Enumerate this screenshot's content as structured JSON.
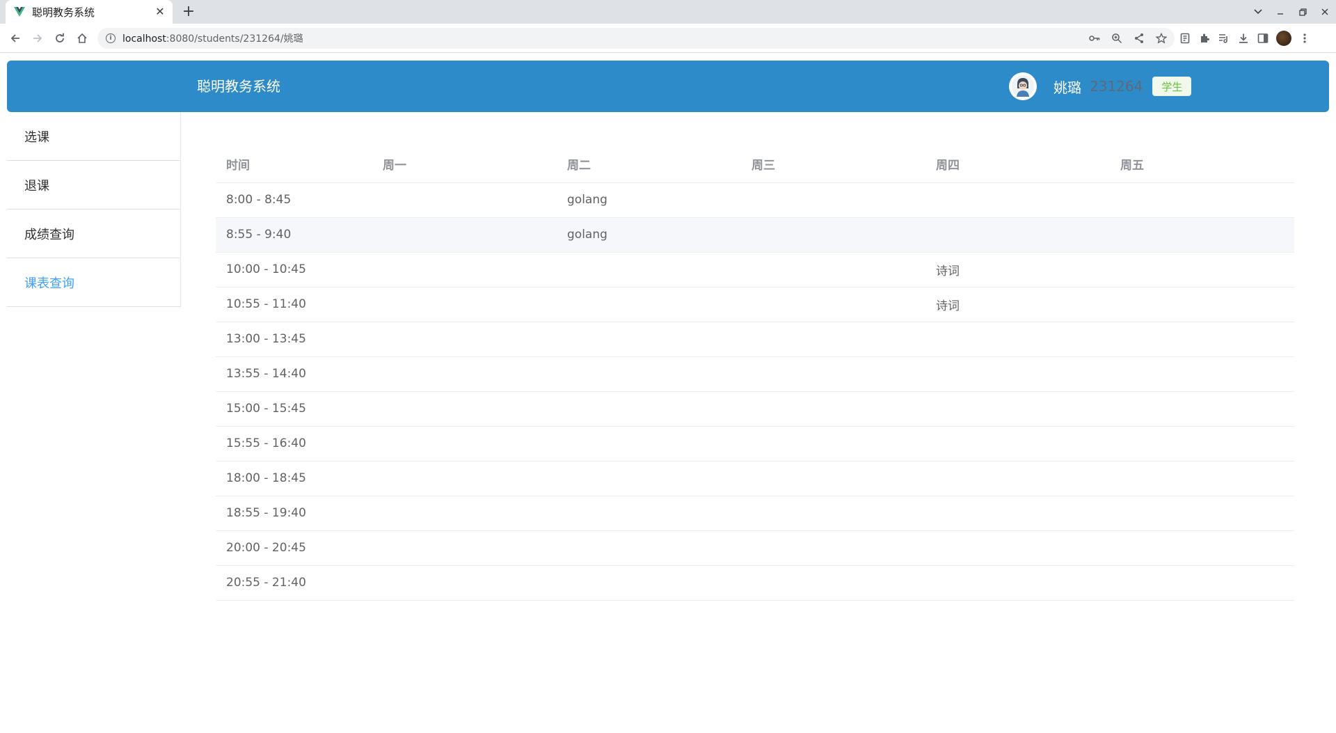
{
  "browser": {
    "tab_title": "聪明教务系统",
    "favicon": "vue-logo-icon",
    "url_host": "localhost",
    "url_rest": ":8080/students/231264/姚璐"
  },
  "header": {
    "title": "聪明教务系统",
    "user_name": "姚璐",
    "user_id": "231264",
    "role": "学生"
  },
  "sidebar": {
    "items": [
      {
        "label": "选课"
      },
      {
        "label": "退课"
      },
      {
        "label": "成绩查询"
      },
      {
        "label": "课表查询"
      }
    ],
    "active_index": 3
  },
  "schedule": {
    "columns": [
      "时间",
      "周一",
      "周二",
      "周三",
      "周四",
      "周五"
    ],
    "rows": [
      [
        "8:00 - 8:45",
        "",
        "golang",
        "",
        "",
        ""
      ],
      [
        "8:55 - 9:40",
        "",
        "golang",
        "",
        "",
        ""
      ],
      [
        "10:00 - 10:45",
        "",
        "",
        "",
        "诗词",
        ""
      ],
      [
        "10:55 - 11:40",
        "",
        "",
        "",
        "诗词",
        ""
      ],
      [
        "13:00 - 13:45",
        "",
        "",
        "",
        "",
        ""
      ],
      [
        "13:55 - 14:40",
        "",
        "",
        "",
        "",
        ""
      ],
      [
        "15:00 - 15:45",
        "",
        "",
        "",
        "",
        ""
      ],
      [
        "15:55 - 16:40",
        "",
        "",
        "",
        "",
        ""
      ],
      [
        "18:00 - 18:45",
        "",
        "",
        "",
        "",
        ""
      ],
      [
        "18:55 - 19:40",
        "",
        "",
        "",
        "",
        ""
      ],
      [
        "20:00 - 20:45",
        "",
        "",
        "",
        "",
        ""
      ],
      [
        "20:55 - 21:40",
        "",
        "",
        "",
        "",
        ""
      ]
    ],
    "highlighted_row": 1
  }
}
